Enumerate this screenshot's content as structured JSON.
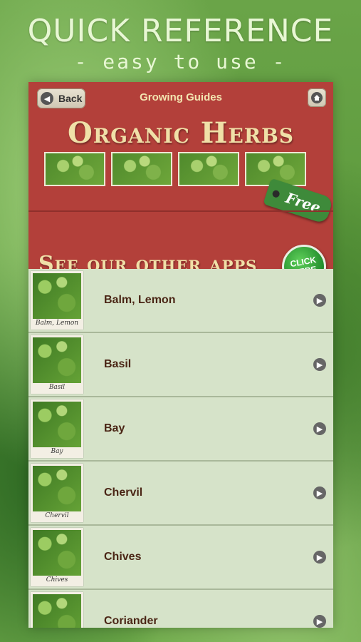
{
  "promo": {
    "title": "QUICK REFERENCE",
    "subtitle": "- easy to use -"
  },
  "navbar": {
    "back_label": "Back",
    "title": "Growing Guides",
    "home_icon": "home-icon"
  },
  "banner": {
    "title": "Organic Herbs",
    "free_label": "Free",
    "other_apps": "See our other apps",
    "click_here": "CLICK HERE"
  },
  "herbs": [
    {
      "label": "Balm, Lemon",
      "caption": "Balm, Lemon"
    },
    {
      "label": "Basil",
      "caption": "Basil"
    },
    {
      "label": "Bay",
      "caption": "Bay"
    },
    {
      "label": "Chervil",
      "caption": "Chervil"
    },
    {
      "label": "Chives",
      "caption": "Chives"
    },
    {
      "label": "Coriander",
      "caption": ""
    }
  ],
  "colors": {
    "navbar": "#b3403a",
    "list_bg": "#d6e3c9",
    "accent_text": "#f0e0a8"
  }
}
